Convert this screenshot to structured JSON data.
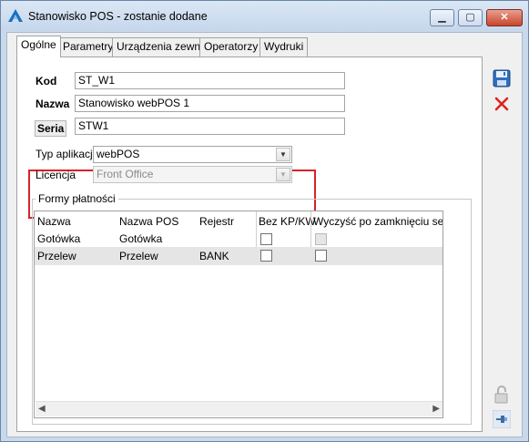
{
  "window": {
    "title": "Stanowisko POS - zostanie dodane",
    "minimize_label": "▁",
    "maximize_label": "▢",
    "close_label": "✕"
  },
  "tabs": [
    {
      "label": "Ogólne",
      "active": true
    },
    {
      "label": "Parametry"
    },
    {
      "label": "Urządzenia zewn."
    },
    {
      "label": "Operatorzy"
    },
    {
      "label": "Wydruki"
    }
  ],
  "form": {
    "kod_label": "Kod",
    "kod_value": "ST_W1",
    "nazwa_label": "Nazwa",
    "nazwa_value": "Stanowisko webPOS 1",
    "seria_label": "Seria",
    "seria_value": "STW1",
    "typ_label": "Typ aplikacji",
    "typ_value": "webPOS",
    "licencja_label": "Licencja",
    "licencja_value": "Front Office"
  },
  "payments": {
    "group_title": "Formy płatności",
    "columns": [
      "Nazwa",
      "Nazwa POS",
      "Rejestr",
      "Bez KP/KW",
      "Wyczyść po zamknięciu sesji"
    ],
    "rows": [
      {
        "nazwa": "Gotówka",
        "nazwa_pos": "Gotówka",
        "rejestr": "",
        "bez_kp_kw": false,
        "wyczysc": false
      },
      {
        "nazwa": "Przelew",
        "nazwa_pos": "Przelew",
        "rejestr": "BANK",
        "bez_kp_kw": false,
        "wyczysc": false
      }
    ]
  },
  "icons": {
    "save": "save-icon",
    "cancel": "cancel-icon",
    "lock": "lock-icon",
    "pin": "pin-icon"
  },
  "colors": {
    "highlight": "#d7222a",
    "titlebar": "#c6d7ec"
  }
}
